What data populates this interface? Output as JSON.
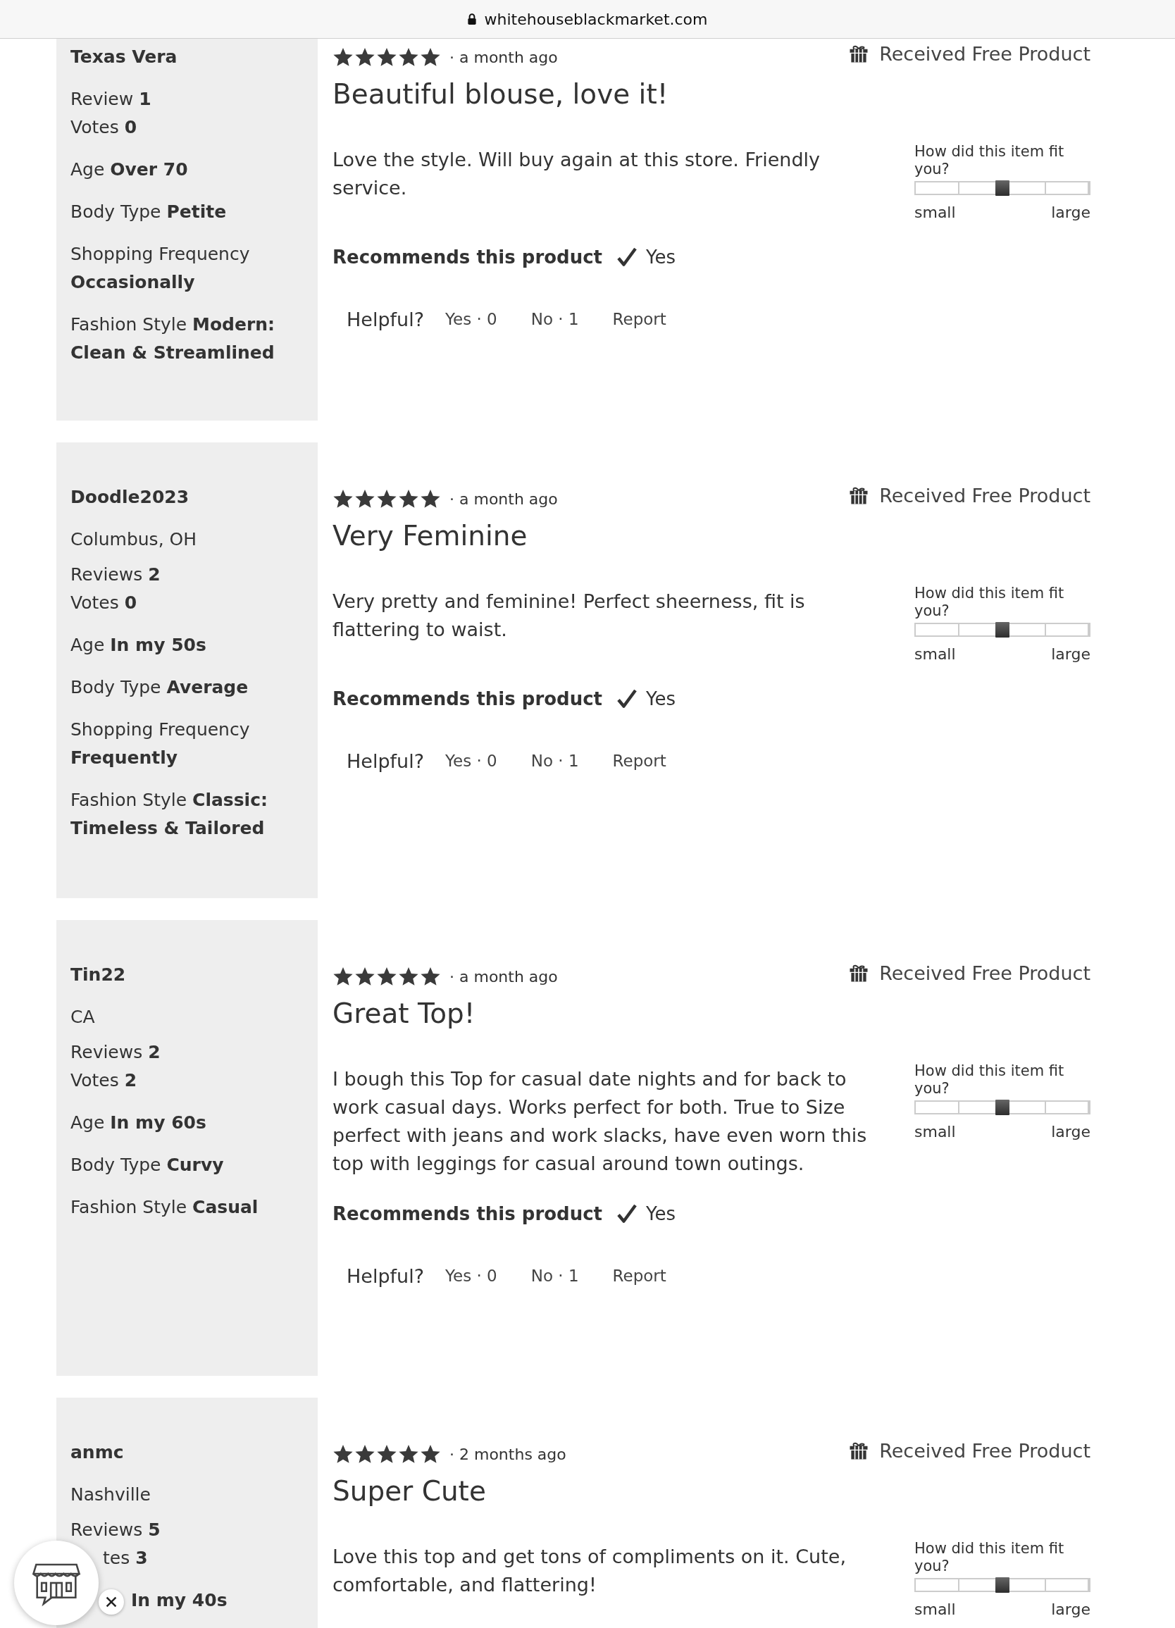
{
  "address_bar": {
    "url": "whitehouseblackmarket.com"
  },
  "reviews": [
    {
      "reviewer": {
        "name": "Texas Vera",
        "stats": [
          "Review **1**",
          "Votes **0**"
        ],
        "attributes": [
          "Age **Over 70**",
          "Body Type **Petite**",
          "Shopping Frequency **Occasionally**",
          "Fashion Style **Modern: Clean & Streamlined**"
        ]
      },
      "stars": 5,
      "time": "· a month ago",
      "badge": "Received Free Product",
      "title": "Beautiful blouse, love it!",
      "body": "Love the style. Will buy again at this store. Friendly service.",
      "fit": {
        "question": "How did this item fit you?",
        "low": "small",
        "high": "large",
        "level": 0.5
      },
      "recommends": {
        "label": "Recommends this product",
        "answer": "Yes"
      },
      "helpful": {
        "label": "Helpful?",
        "yes": "Yes · 0",
        "no": "No · 1",
        "report": "Report"
      }
    },
    {
      "reviewer": {
        "name": "Doodle2023",
        "location": "Columbus, OH",
        "stats": [
          "Reviews **2**",
          "Votes **0**"
        ],
        "attributes": [
          "Age **In my 50s**",
          "Body Type **Average**",
          "Shopping Frequency **Frequently**",
          "Fashion Style **Classic: Timeless & Tailored**"
        ]
      },
      "stars": 5,
      "time": "· a month ago",
      "badge": "Received Free Product",
      "title": "Very Feminine",
      "body": "Very pretty and feminine! Perfect sheerness, fit is flattering to waist.",
      "fit": {
        "question": "How did this item fit you?",
        "low": "small",
        "high": "large",
        "level": 0.5
      },
      "recommends": {
        "label": "Recommends this product",
        "answer": "Yes"
      },
      "helpful": {
        "label": "Helpful?",
        "yes": "Yes · 0",
        "no": "No · 1",
        "report": "Report"
      }
    },
    {
      "reviewer": {
        "name": "Tin22",
        "location": "CA",
        "stats": [
          "Reviews **2**",
          "Votes **2**"
        ],
        "attributes": [
          "Age **In my 60s**",
          "Body Type **Curvy**",
          "Fashion Style **Casual**"
        ]
      },
      "stars": 5,
      "time": "· a month ago",
      "badge": "Received Free Product",
      "title": "Great Top!",
      "body": "I bough this Top for casual date nights and for back to work casual days. Works perfect for both. True to Size perfect with jeans and work slacks, have even worn this top with leggings for casual around town outings.",
      "fit": {
        "question": "How did this item fit you?",
        "low": "small",
        "high": "large",
        "level": 0.5
      },
      "recommends": {
        "label": "Recommends this product",
        "answer": "Yes"
      },
      "helpful": {
        "label": "Helpful?",
        "yes": "Yes · 0",
        "no": "No · 1",
        "report": "Report"
      }
    },
    {
      "reviewer": {
        "name": "anmc",
        "location": "Nashville",
        "stats": [
          "Reviews **5**",
          "tes **3**"
        ],
        "attributes": [
          "**In my 40s**"
        ]
      },
      "stars": 5,
      "time": "· 2 months ago",
      "badge": "Received Free Product",
      "title": "Super Cute",
      "body": "Love this top and get tons of compliments on it. Cute, comfortable, and flattering!",
      "fit": {
        "question": "How did this item fit you?",
        "low": "small",
        "high": "large",
        "level": 0.5
      }
    }
  ]
}
